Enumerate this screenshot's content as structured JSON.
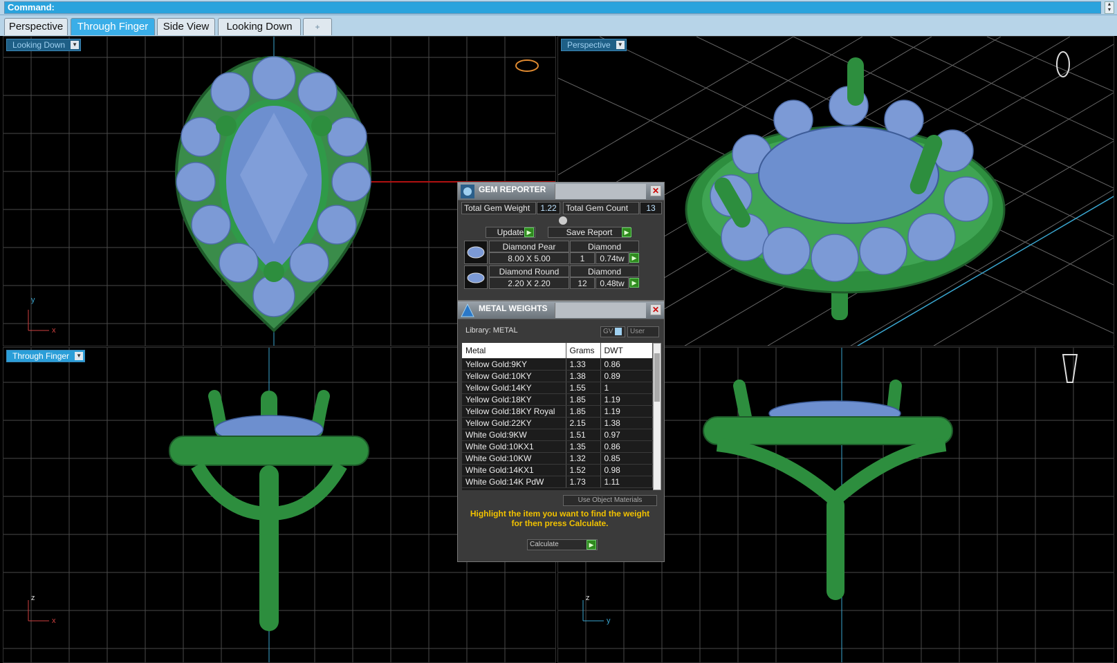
{
  "command": {
    "label": "Command:"
  },
  "tabs": [
    {
      "label": "Perspective",
      "active": false
    },
    {
      "label": "Through Finger",
      "active": true
    },
    {
      "label": "Side View",
      "active": false
    },
    {
      "label": "Looking Down",
      "active": false
    },
    {
      "label": "+",
      "active": false
    }
  ],
  "viewports": {
    "top_left": {
      "label": "Looking Down",
      "axis_v": "y",
      "axis_h": "x"
    },
    "top_right": {
      "label": "Perspective"
    },
    "bottom_left": {
      "label": "Through Finger",
      "axis_v": "z",
      "axis_h": "x"
    },
    "bottom_right": {
      "axis_v": "z",
      "axis_h": "y"
    }
  },
  "gem_reporter": {
    "title": "GEM REPORTER",
    "total_weight_label": "Total Gem Weight",
    "total_weight": "1.22",
    "total_count_label": "Total Gem Count",
    "total_count": "13",
    "update_label": "Update",
    "save_report_label": "Save Report",
    "gems": [
      {
        "name": "Diamond Pear",
        "material": "Diamond",
        "size": "8.00 X 5.00",
        "count": "1",
        "weight": "0.74tw"
      },
      {
        "name": "Diamond Round",
        "material": "Diamond",
        "size": "2.20 X 2.20",
        "count": "12",
        "weight": "0.48tw"
      }
    ]
  },
  "metal_weights": {
    "title": "METAL WEIGHTS",
    "library": "Library: METAL",
    "gv_label": "GV",
    "user_label": "User",
    "columns": [
      "Metal",
      "Grams",
      "DWT"
    ],
    "rows": [
      [
        "Yellow Gold:9KY",
        "1.33",
        "0.86"
      ],
      [
        "Yellow Gold:10KY",
        "1.38",
        "0.89"
      ],
      [
        "Yellow Gold:14KY",
        "1.55",
        "1"
      ],
      [
        "Yellow Gold:18KY",
        "1.85",
        "1.19"
      ],
      [
        "Yellow Gold:18KY Royal",
        "1.85",
        "1.19"
      ],
      [
        "Yellow Gold:22KY",
        "2.15",
        "1.38"
      ],
      [
        "White Gold:9KW",
        "1.51",
        "0.97"
      ],
      [
        "White Gold:10KX1",
        "1.35",
        "0.86"
      ],
      [
        "White Gold:10KW",
        "1.32",
        "0.85"
      ],
      [
        "White Gold:14KX1",
        "1.52",
        "0.98"
      ],
      [
        "White Gold:14K PdW",
        "1.73",
        "1.11"
      ]
    ],
    "use_object_materials": "Use Object Materials",
    "hint": "Highlight the item you want to find the weight for then press Calculate.",
    "calculate_label": "Calculate"
  }
}
